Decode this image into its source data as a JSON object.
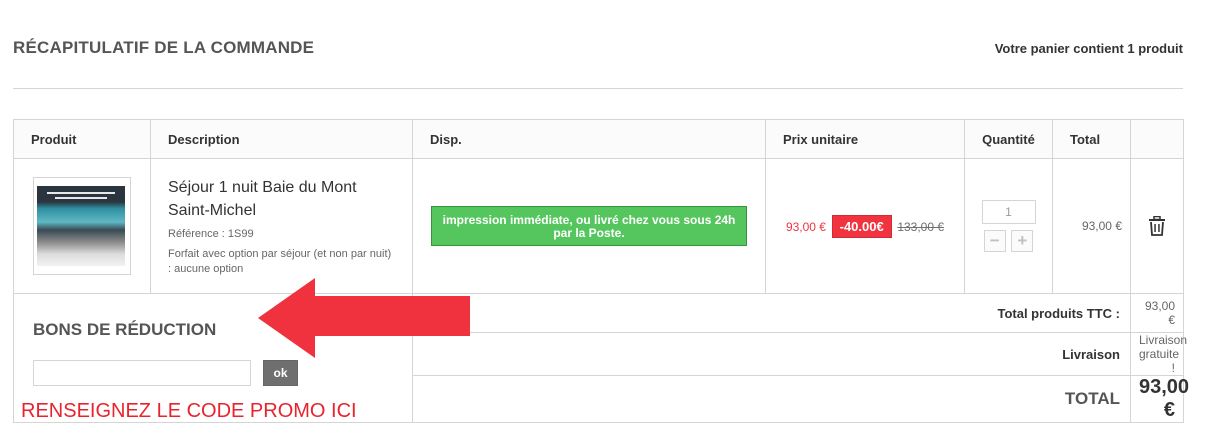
{
  "header": {
    "title": "RÉCAPITULATIF DE LA COMMANDE",
    "cart_count": "Votre panier contient 1 produit"
  },
  "table": {
    "columns": [
      "Produit",
      "Description",
      "Disp.",
      "Prix unitaire",
      "Quantité",
      "Total",
      ""
    ],
    "item": {
      "name": "Séjour 1 nuit Baie du Mont Saint-Michel",
      "reference": "Référence : 1S99",
      "attribute": "Forfait avec option par séjour (et non par nuit) : aucune option",
      "availability": "impression immédiate, ou livré chez vous sous 24h par la Poste.",
      "price_new": "93,00 €",
      "discount": "-40.00€",
      "price_old": "133,00 €",
      "quantity": "1",
      "qty_minus": "−",
      "qty_plus": "+",
      "total": "93,00 €",
      "image_icon": "product-thumbnail-icon",
      "delete_icon": "trash-icon"
    }
  },
  "summary": {
    "products_label": "Total produits TTC :",
    "products_value": "93,00 €",
    "shipping_label": "Livraison",
    "shipping_value": "Livraison gratuite !",
    "total_label": "TOTAL",
    "total_value": "93,00 €"
  },
  "voucher": {
    "title": "BONS DE RÉDUCTION",
    "input_value": "",
    "button_label": "ok",
    "hint": "RENSEIGNEZ LE CODE PROMO ICI"
  },
  "colors": {
    "availability_green": "#55c65e",
    "discount_red": "#f13340",
    "hint_red": "#e8232e",
    "arrow_red": "#f0323e"
  }
}
